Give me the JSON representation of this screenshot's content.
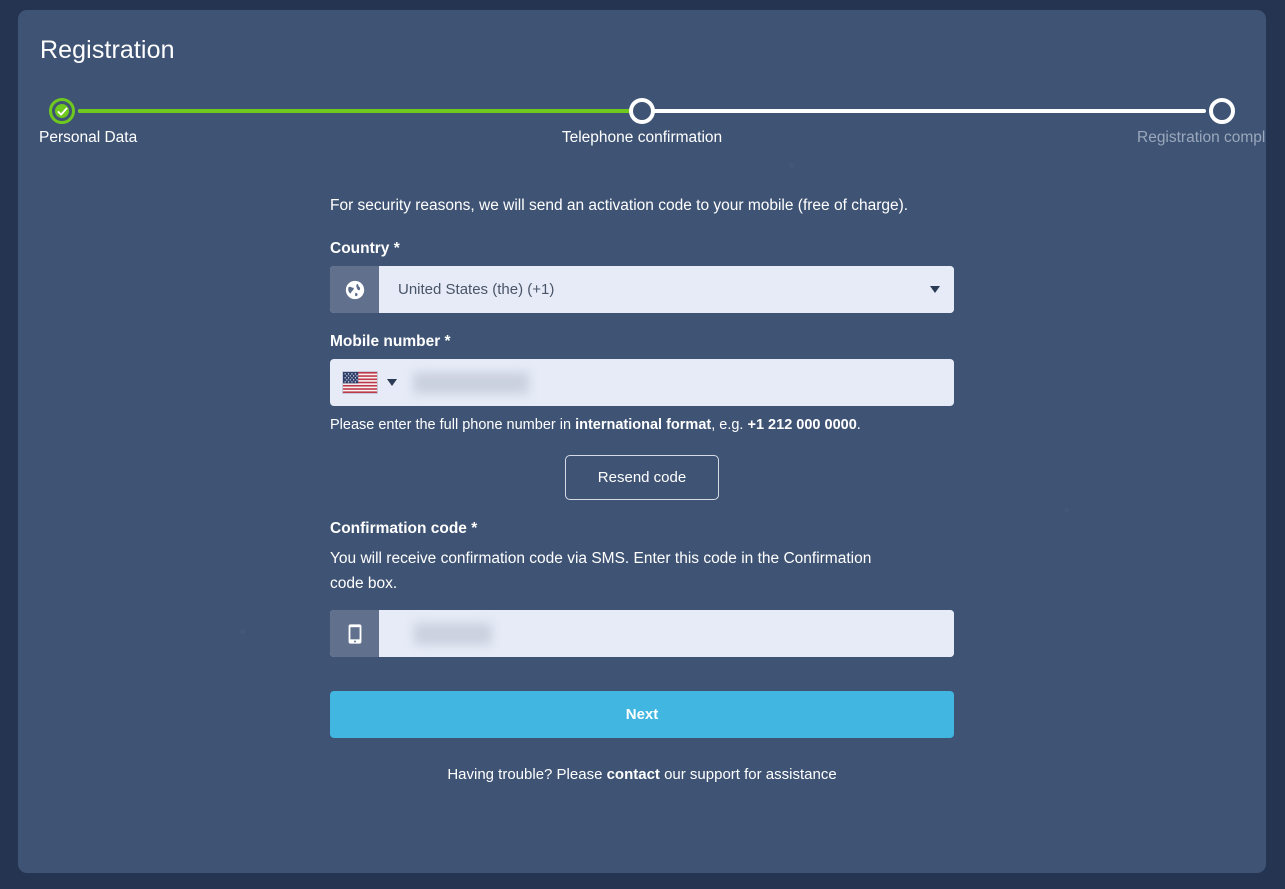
{
  "page": {
    "title": "Registration"
  },
  "stepper": {
    "steps": [
      {
        "label": "Personal Data",
        "state": "done",
        "icon": "check-icon"
      },
      {
        "label": "Telephone confirmation",
        "state": "current",
        "icon": "play-icon"
      },
      {
        "label": "Registration complete",
        "state": "todo",
        "icon": "circle-icon"
      }
    ],
    "progress_percent": 50,
    "done_color": "#6ec81e",
    "track_color": "#ffffff"
  },
  "form": {
    "intro": "For security reasons, we will send an activation code to your mobile (free of charge).",
    "country": {
      "label": "Country *",
      "icon": "globe-icon",
      "value": "United States (the) (+1)",
      "caret": "chevron-down-icon"
    },
    "mobile": {
      "label": "Mobile number *",
      "flag": "us-flag-icon",
      "caret": "chevron-down-icon",
      "value": "",
      "redacted": true,
      "hint_prefix": "Please enter the full phone number in ",
      "hint_bold_1": "international format",
      "hint_middle": ", e.g. ",
      "hint_bold_2": "+1 212 000 0000",
      "hint_suffix": "."
    },
    "resend": {
      "label": "Resend code"
    },
    "confirmation": {
      "label": "Confirmation code *",
      "description": "You will receive confirmation code via SMS. Enter this code in the Confirmation code box.",
      "icon": "mobile-phone-icon",
      "value": "",
      "redacted": true
    },
    "submit": {
      "label": "Next",
      "color": "#40b6e0"
    }
  },
  "footer": {
    "text_before": "Having trouble? Please ",
    "link": "contact",
    "text_after": " our support for assistance"
  }
}
